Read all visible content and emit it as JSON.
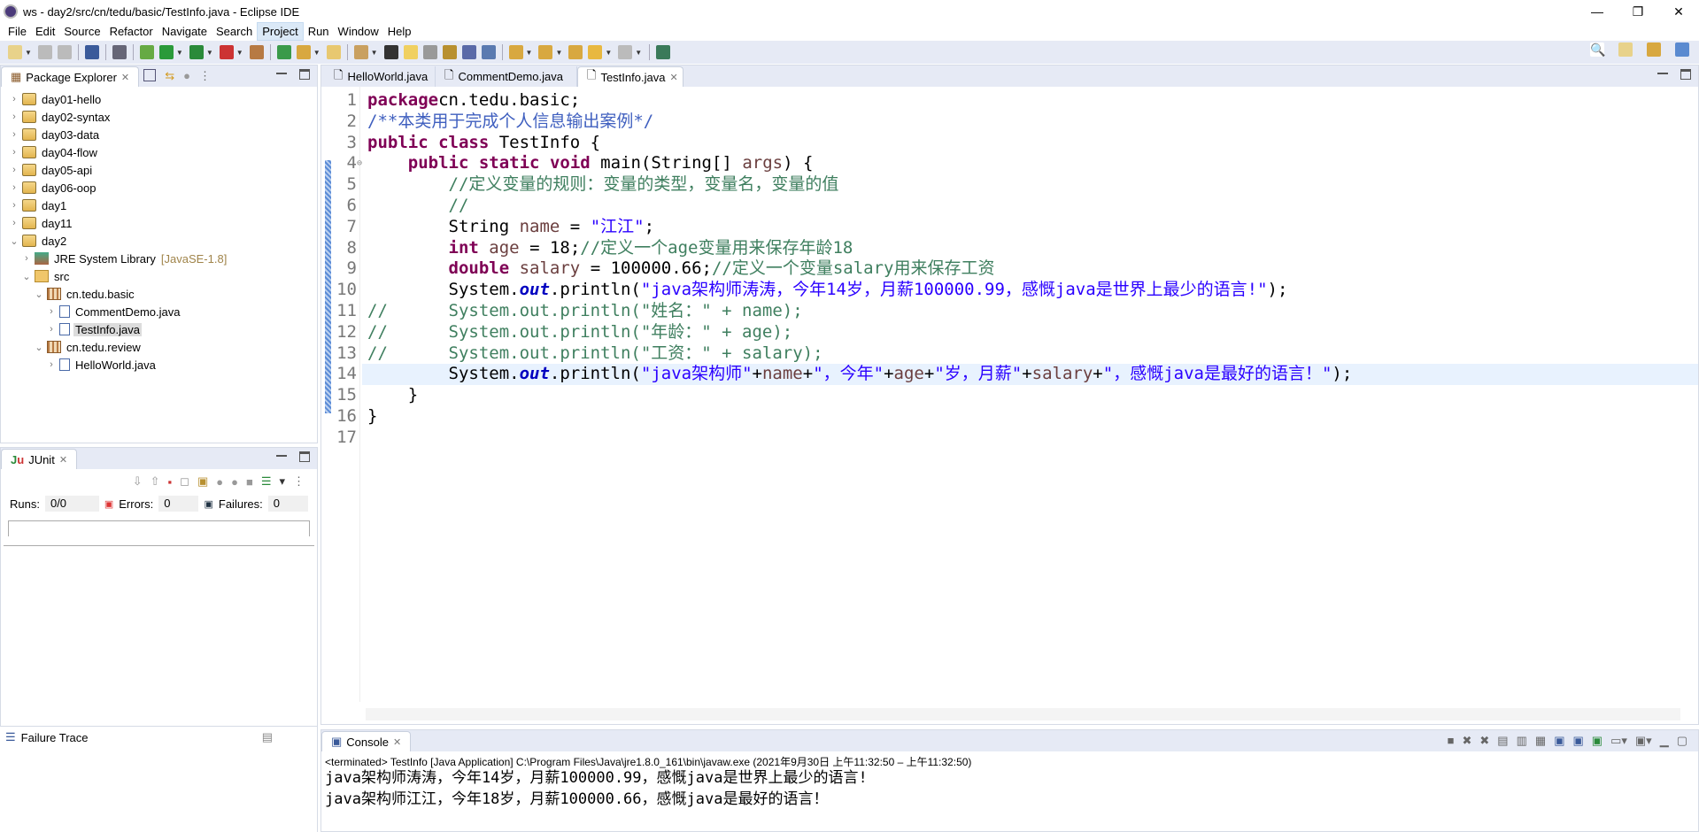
{
  "window": {
    "title": "ws - day2/src/cn/tedu/basic/TestInfo.java - Eclipse IDE",
    "controls": [
      "—",
      "❐",
      "✕"
    ]
  },
  "menu": [
    "File",
    "Edit",
    "Source",
    "Refactor",
    "Navigate",
    "Search",
    "Project",
    "Run",
    "Window",
    "Help"
  ],
  "menu_active": "Project",
  "toolbar": {
    "icons": [
      "new-icon",
      "save-icon",
      "save-all-icon",
      "terminal-icon",
      "skip-breakpoints-icon",
      "debug-icon",
      "run-icon",
      "coverage-icon",
      "external-tools-icon",
      "new-java-project-icon",
      "new-class-icon",
      "open-type-icon",
      "open-task-icon",
      "search-icon",
      "annotation-icon",
      "mark-occurrences-icon",
      "word-wrap-icon",
      "block-selection-icon",
      "show-whitespace-icon",
      "pilcrow-icon",
      "next-annotation-icon",
      "prev-annotation-icon",
      "last-edit-icon",
      "back-icon",
      "forward-icon",
      "pin-editor-icon"
    ],
    "right_icons": [
      "search-icon",
      "open-perspective-icon",
      "java-ee-perspective-icon",
      "java-perspective-icon"
    ]
  },
  "package_explorer": {
    "title": "Package Explorer",
    "items": [
      {
        "label": "day01-hello",
        "type": "proj",
        "depth": 0,
        "open": false
      },
      {
        "label": "day02-syntax",
        "type": "proj",
        "depth": 0,
        "open": false
      },
      {
        "label": "day03-data",
        "type": "proj",
        "depth": 0,
        "open": false
      },
      {
        "label": "day04-flow",
        "type": "proj",
        "depth": 0,
        "open": false
      },
      {
        "label": "day05-api",
        "type": "proj",
        "depth": 0,
        "open": false
      },
      {
        "label": "day06-oop",
        "type": "proj",
        "depth": 0,
        "open": false
      },
      {
        "label": "day1",
        "type": "proj",
        "depth": 0,
        "open": false
      },
      {
        "label": "day11",
        "type": "proj",
        "depth": 0,
        "open": false
      },
      {
        "label": "day2",
        "type": "proj",
        "depth": 0,
        "open": true
      },
      {
        "label": "JRE System Library",
        "deco": "[JavaSE-1.8]",
        "type": "lib",
        "depth": 1,
        "open": false
      },
      {
        "label": "src",
        "type": "srcf",
        "depth": 1,
        "open": true
      },
      {
        "label": "cn.tedu.basic",
        "type": "pkg",
        "depth": 2,
        "open": true
      },
      {
        "label": "CommentDemo.java",
        "type": "jfile",
        "depth": 3,
        "open": false
      },
      {
        "label": "TestInfo.java",
        "type": "jfile",
        "depth": 3,
        "open": false,
        "selected": true
      },
      {
        "label": "cn.tedu.review",
        "type": "pkg",
        "depth": 2,
        "open": true
      },
      {
        "label": "HelloWorld.java",
        "type": "jfile",
        "depth": 3,
        "open": false
      }
    ]
  },
  "junit": {
    "title": "JUnit",
    "runs_label": "Runs:",
    "runs": "0/0",
    "errors_label": "Errors:",
    "errors": "0",
    "failures_label": "Failures:",
    "failures": "0",
    "failure_trace": "Failure Trace"
  },
  "editor": {
    "tabs": [
      "HelloWorld.java",
      "CommentDemo.java",
      "TestInfo.java"
    ],
    "active_tab": "TestInfo.java",
    "current_line": 14,
    "lines": [
      [
        [
          "kw",
          "package"
        ],
        [
          "",
          "cn.tedu.basic;"
        ]
      ],
      [
        [
          "jdoc",
          "/**本类用于完成个人信息输出案例*/"
        ]
      ],
      [
        [
          "kw",
          "public"
        ],
        [
          "",
          " "
        ],
        [
          "kw",
          "class"
        ],
        [
          "",
          " TestInfo {"
        ]
      ],
      [
        [
          "",
          "    "
        ],
        [
          "kw",
          "public"
        ],
        [
          "",
          " "
        ],
        [
          "kw",
          "static"
        ],
        [
          "",
          " "
        ],
        [
          "kw",
          "void"
        ],
        [
          "",
          " main(String[] "
        ],
        [
          "var",
          "args"
        ],
        [
          "",
          ") {"
        ]
      ],
      [
        [
          "",
          "        "
        ],
        [
          "cmt",
          "//定义变量的规则：变量的类型，变量名，变量的值"
        ]
      ],
      [
        [
          "",
          "        "
        ],
        [
          "cmt",
          "//"
        ]
      ],
      [
        [
          "",
          "        String "
        ],
        [
          "var",
          "name"
        ],
        [
          "",
          " = "
        ],
        [
          "str",
          "\"江江\""
        ],
        [
          "",
          ";"
        ]
      ],
      [
        [
          "",
          "        "
        ],
        [
          "kw",
          "int"
        ],
        [
          "",
          " "
        ],
        [
          "var",
          "age"
        ],
        [
          "",
          " = 18;"
        ],
        [
          "cmt",
          "//定义一个age变量用来保存年龄18"
        ]
      ],
      [
        [
          "",
          "        "
        ],
        [
          "kw",
          "double"
        ],
        [
          "",
          " "
        ],
        [
          "var",
          "salary"
        ],
        [
          "",
          " = 100000.66;"
        ],
        [
          "cmt",
          "//定义一个变量salary用来保存工资"
        ]
      ],
      [
        [
          "",
          "        System."
        ],
        [
          "fld",
          "out"
        ],
        [
          "",
          ".println("
        ],
        [
          "str",
          "\"java架构师涛涛，今年14岁，月薪100000.99，感慨java是世界上最少的语言!\""
        ],
        [
          "",
          ");"
        ]
      ],
      [
        [
          "cmt",
          "//      System.out.println(\"姓名：\" + name);"
        ]
      ],
      [
        [
          "cmt",
          "//      System.out.println(\"年龄：\" + age);"
        ]
      ],
      [
        [
          "cmt",
          "//      System.out.println(\"工资：\" + salary);"
        ]
      ],
      [
        [
          "",
          "        System."
        ],
        [
          "fld",
          "out"
        ],
        [
          "",
          ".println("
        ],
        [
          "str",
          "\"java架构师\""
        ],
        [
          "",
          "+"
        ],
        [
          "var",
          "name"
        ],
        [
          "",
          "+"
        ],
        [
          "str",
          "\"，今年\""
        ],
        [
          "",
          "+"
        ],
        [
          "var",
          "age"
        ],
        [
          "",
          "+"
        ],
        [
          "str",
          "\"岁，月薪\""
        ],
        [
          "",
          "+"
        ],
        [
          "var",
          "salary"
        ],
        [
          "",
          "+"
        ],
        [
          "str",
          "\"，感慨java是最好的语言！\""
        ],
        [
          "",
          ");"
        ]
      ],
      [
        [
          "",
          "    }"
        ]
      ],
      [
        [
          "",
          "}"
        ]
      ],
      [
        [
          "",
          ""
        ]
      ]
    ]
  },
  "console": {
    "title": "Console",
    "status": "<terminated> TestInfo [Java Application] C:\\Program Files\\Java\\jre1.8.0_161\\bin\\javaw.exe  (2021年9月30日 上午11:32:50 – 上午11:32:50)",
    "output": [
      "java架构师涛涛，今年14岁，月薪100000.99，感慨java是世界上最少的语言!",
      "java架构师江江，今年18岁，月薪100000.66，感慨java是最好的语言！"
    ]
  },
  "colors": {
    "keyword": "#7f0055",
    "string": "#2a00ff",
    "comment": "#3f7f5f",
    "javadoc": "#3f5fbf",
    "variable": "#6a3e3e",
    "current_line": "#e8f2fe",
    "toolbar_bg": "#e6eaf5"
  }
}
